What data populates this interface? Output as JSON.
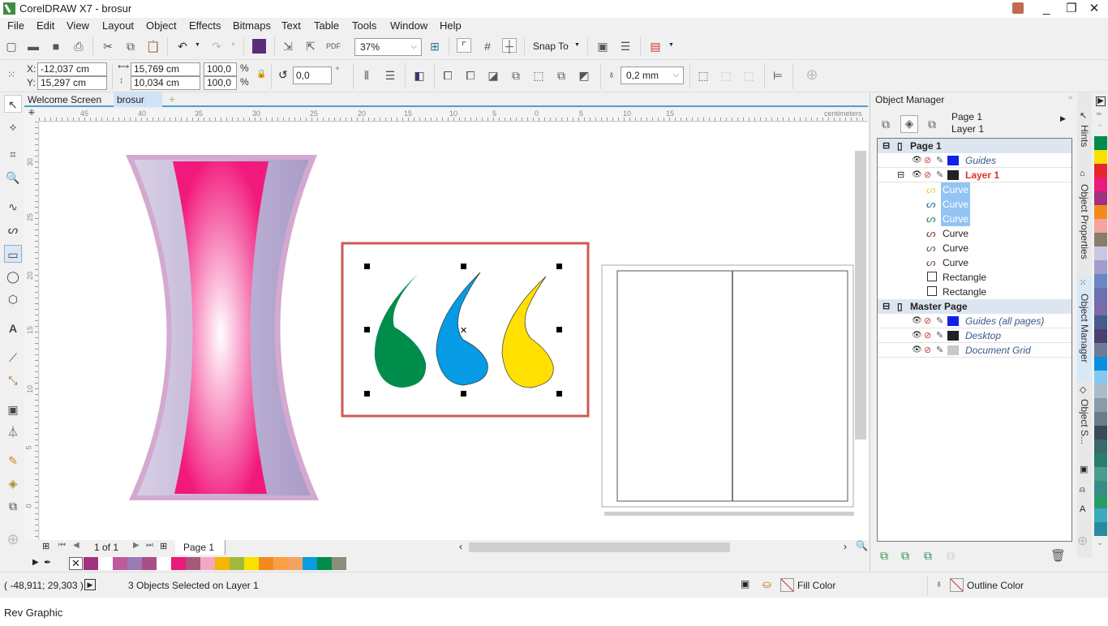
{
  "window": {
    "title": "CorelDRAW X7 - brosur",
    "minimize": "_",
    "restore": "❐",
    "close": "✕"
  },
  "menu": [
    "File",
    "Edit",
    "View",
    "Layout",
    "Object",
    "Effects",
    "Bitmaps",
    "Text",
    "Table",
    "Tools",
    "Window",
    "Help"
  ],
  "toolbar": {
    "zoom_level": "37%",
    "snap_to_label": "Snap To"
  },
  "property_bar": {
    "x_label": "X:",
    "x_value": "-12,037 cm",
    "y_label": "Y:",
    "y_value": "15,297 cm",
    "width_value": "15,769 cm",
    "height_value": "10,034 cm",
    "scale_x": "100,0",
    "scale_y": "100,0",
    "percent": "%",
    "rotation": "0,0",
    "degree": "°",
    "outline_width": "0,2 mm"
  },
  "doc_tabs": [
    {
      "label": "Welcome Screen",
      "active": false
    },
    {
      "label": "brosur",
      "active": true
    }
  ],
  "rulers": {
    "unit": "centimeters",
    "horizontal_ticks": [
      "45",
      "40",
      "35",
      "30",
      "25",
      "20",
      "15",
      "10",
      "5",
      "0",
      "5",
      "10",
      "15"
    ],
    "vertical_ticks": [
      "30",
      "25",
      "20",
      "15",
      "10",
      "5",
      "0"
    ]
  },
  "page_nav": {
    "counter": "1 of 1",
    "page_tab": "Page 1"
  },
  "document_palette": [
    "#a2317f",
    "#ffffff",
    "#c05a9b",
    "#9a7bb5",
    "#a84f87",
    "#ffffff",
    "#ea1b7b",
    "#a75778",
    "#f3a7c2",
    "#f6b500",
    "#9fba3a",
    "#f9e000",
    "#f48a1e",
    "#f9a046",
    "#f7a160",
    "#0a9be1",
    "#008c4a",
    "#8b8e7a"
  ],
  "canvas": {
    "drops": [
      {
        "name": "green-drop",
        "color": "#008c4a"
      },
      {
        "name": "blue-drop",
        "color": "#079be6"
      },
      {
        "name": "yellow-drop",
        "color": "#ffe000"
      }
    ],
    "selection_frame_color": "#cc5a55"
  },
  "status": {
    "coords": "( -48,911; 29,303 )",
    "message": "3 Objects Selected on Layer 1",
    "fill_label": "Fill Color",
    "outline_label": "Outline Color"
  },
  "footer": {
    "text": "Rev Graphic"
  },
  "object_manager": {
    "title": "Object Manager",
    "current_page": "Page 1",
    "current_layer": "Layer 1",
    "tree": [
      {
        "type": "page",
        "label": "Page 1"
      },
      {
        "type": "layer",
        "label": "Guides",
        "swatch": "#1020e8",
        "italic": true
      },
      {
        "type": "layer",
        "label": "Layer 1",
        "swatch": "#222222",
        "active": true
      },
      {
        "type": "object",
        "label": "Curve",
        "icon_color": "#e8d44a",
        "selected": true
      },
      {
        "type": "object",
        "label": "Curve",
        "icon_color": "#2a7ca0",
        "selected": true
      },
      {
        "type": "object",
        "label": "Curve",
        "icon_color": "#2c8c5a",
        "selected": true
      },
      {
        "type": "object",
        "label": "Curve",
        "icon_color": "#8a3a5a",
        "selected": false
      },
      {
        "type": "object",
        "label": "Curve",
        "icon_color": "#7a5a7a",
        "selected": false
      },
      {
        "type": "object",
        "label": "Curve",
        "icon_color": "#7a4a7a",
        "selected": false
      },
      {
        "type": "rect",
        "label": "Rectangle"
      },
      {
        "type": "rect",
        "label": "Rectangle"
      },
      {
        "type": "page",
        "label": "Master Page"
      },
      {
        "type": "layer",
        "label": "Guides (all pages)",
        "swatch": "#1020e8",
        "italic": true
      },
      {
        "type": "layer",
        "label": "Desktop",
        "swatch": "#222222",
        "italic": true
      },
      {
        "type": "layer",
        "label": "Document Grid",
        "swatch": "#c8c8c8",
        "italic": true
      }
    ]
  },
  "docker_tabs": [
    "Hints",
    "Object Properties",
    "Object Manager",
    "Object S..."
  ],
  "color_palette": [
    "#008c4a",
    "#f9e000",
    "#e8262b",
    "#ea1b7b",
    "#a2317f",
    "#f48a1e",
    "#f7a3a0",
    "#8b7d6b",
    "#c8c8e0",
    "#a49ccc",
    "#6d86c4",
    "#6a70b0",
    "#7a6aa8",
    "#465a8c",
    "#4a4070",
    "#6e7c9a",
    "#0a8ee0",
    "#88c8ec",
    "#a8bccc",
    "#8a9cac",
    "#6a7c8c",
    "#3a4a5a",
    "#3a6a6a",
    "#2a7c6c",
    "#4a9c8c",
    "#3a8a8a",
    "#2a9a6a",
    "#3aaabc",
    "#2a8aa0"
  ]
}
